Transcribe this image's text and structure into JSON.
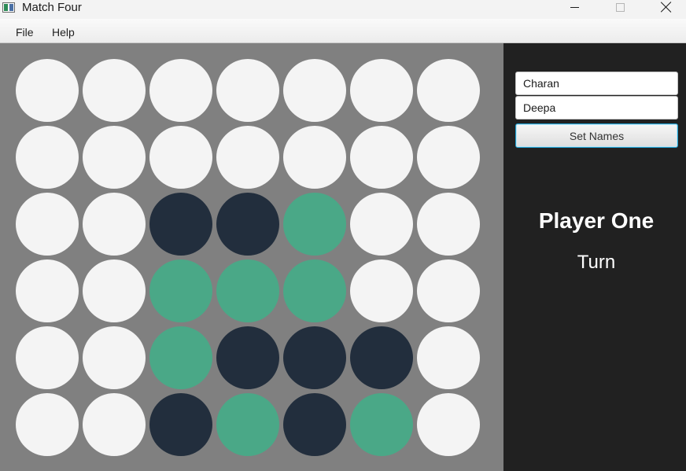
{
  "window": {
    "title": "Match Four",
    "icon": "app-icon"
  },
  "menu": {
    "items": [
      "File",
      "Help"
    ]
  },
  "board": {
    "rows": 6,
    "columns": 7,
    "cells": [
      [
        "empty",
        "empty",
        "empty",
        "empty",
        "empty",
        "empty",
        "empty"
      ],
      [
        "empty",
        "empty",
        "empty",
        "empty",
        "empty",
        "empty",
        "empty"
      ],
      [
        "empty",
        "empty",
        "dark",
        "dark",
        "green",
        "empty",
        "empty"
      ],
      [
        "empty",
        "empty",
        "green",
        "green",
        "green",
        "empty",
        "empty"
      ],
      [
        "empty",
        "empty",
        "green",
        "dark",
        "dark",
        "dark",
        "empty"
      ],
      [
        "empty",
        "empty",
        "dark",
        "green",
        "dark",
        "green",
        "empty"
      ]
    ],
    "colors": {
      "empty": "#f4f4f4",
      "dark": "#222e3d",
      "green": "#4aa887",
      "background": "#808080"
    }
  },
  "sidebar": {
    "player_one_name": "Charan",
    "player_two_name": "Deepa",
    "set_names_label": "Set Names",
    "current_player": "Player One",
    "turn_label": "Turn",
    "background": "#212121"
  }
}
